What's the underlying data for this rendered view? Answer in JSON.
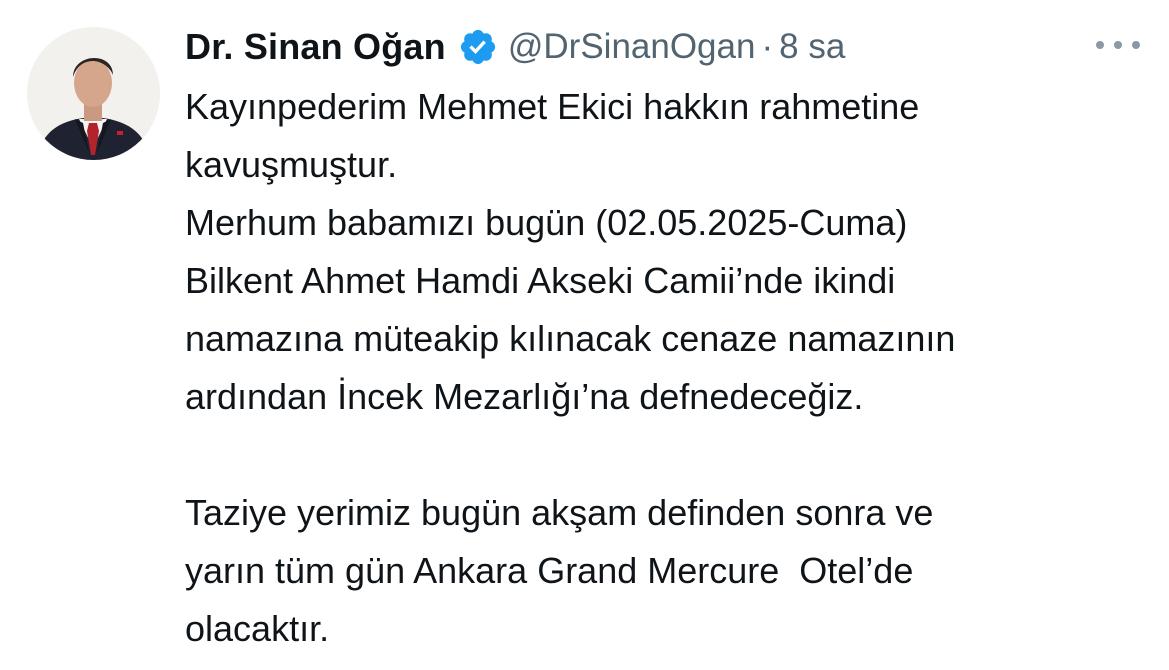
{
  "tweet": {
    "author_name": "Dr. Sinan Oğan",
    "handle": "@DrSinanOgan",
    "separator": "·",
    "time": "8 sa",
    "verified_icon": "verified-badge-icon",
    "more_icon": "more-options-icon",
    "accent_color": "#1d9bf0",
    "lines": [
      "Kayınpederim Mehmet Ekici hakkın rahmetine",
      "kavuşmuştur.",
      "Merhum babamızı bugün (02.05.2025-Cuma)",
      "Bilkent Ahmet Hamdi Akseki Camii’nde ikindi",
      "namazına müteakip kılınacak cenaze namazının",
      "ardından İncek Mezarlığı’na defnedeceğiz.",
      "Taziye yerimiz bugün akşam definden sonra ve",
      "yarın tüm gün Ankara Grand Mercure  Otel’de",
      "olacaktır."
    ]
  }
}
